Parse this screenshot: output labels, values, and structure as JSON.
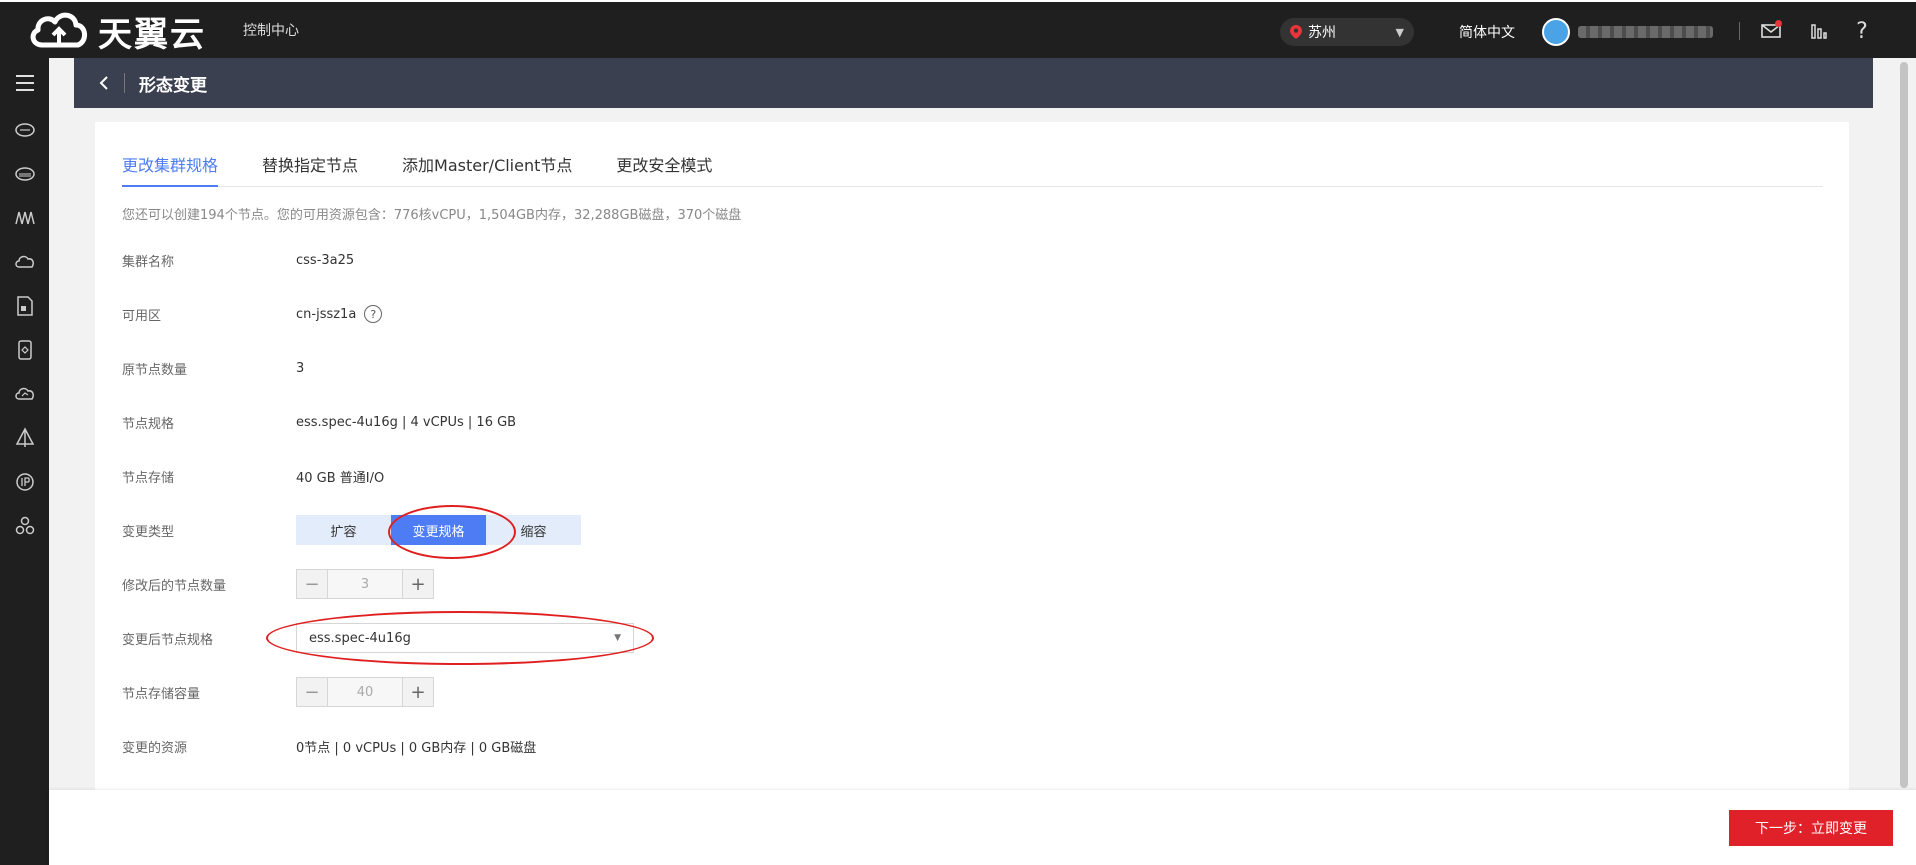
{
  "topbar": {
    "logo_text": "天翼云",
    "console": "控制中心",
    "region": "苏州",
    "language": "简体中文"
  },
  "header": {
    "title": "形态变更"
  },
  "tabs": [
    {
      "label": "更改集群规格",
      "active": true
    },
    {
      "label": "替换指定节点",
      "active": false
    },
    {
      "label": "添加Master/Client节点",
      "active": false
    },
    {
      "label": "更改安全模式",
      "active": false
    }
  ],
  "notice": "您还可以创建194个节点。您的可用资源包含：776核vCPU，1,504GB内存，32,288GB磁盘，370个磁盘",
  "form": {
    "cluster_name": {
      "label": "集群名称",
      "value": "css-3a25"
    },
    "az": {
      "label": "可用区",
      "value": "cn-jssz1a"
    },
    "orig_nodes": {
      "label": "原节点数量",
      "value": "3"
    },
    "node_spec": {
      "label": "节点规格",
      "value": "ess.spec-4u16g | 4 vCPUs | 16 GB"
    },
    "node_storage": {
      "label": "节点存储",
      "value": "40 GB 普通I/O"
    },
    "change_type": {
      "label": "变更类型",
      "options": [
        "扩容",
        "变更规格",
        "缩容"
      ],
      "selected": "变更规格"
    },
    "new_node_count": {
      "label": "修改后的节点数量",
      "value": "3"
    },
    "new_spec": {
      "label": "变更后节点规格",
      "value": "ess.spec-4u16g"
    },
    "storage_capacity": {
      "label": "节点存储容量",
      "value": "40"
    },
    "changed_resources": {
      "label": "变更的资源",
      "value": "0节点 | 0 vCPUs | 0 GB内存 | 0 GB磁盘"
    }
  },
  "footer": {
    "next_button": "下一步：立即变更"
  },
  "colors": {
    "accent": "#4d7cf4",
    "primary_action": "#e0212a",
    "annotation": "#e02020"
  }
}
